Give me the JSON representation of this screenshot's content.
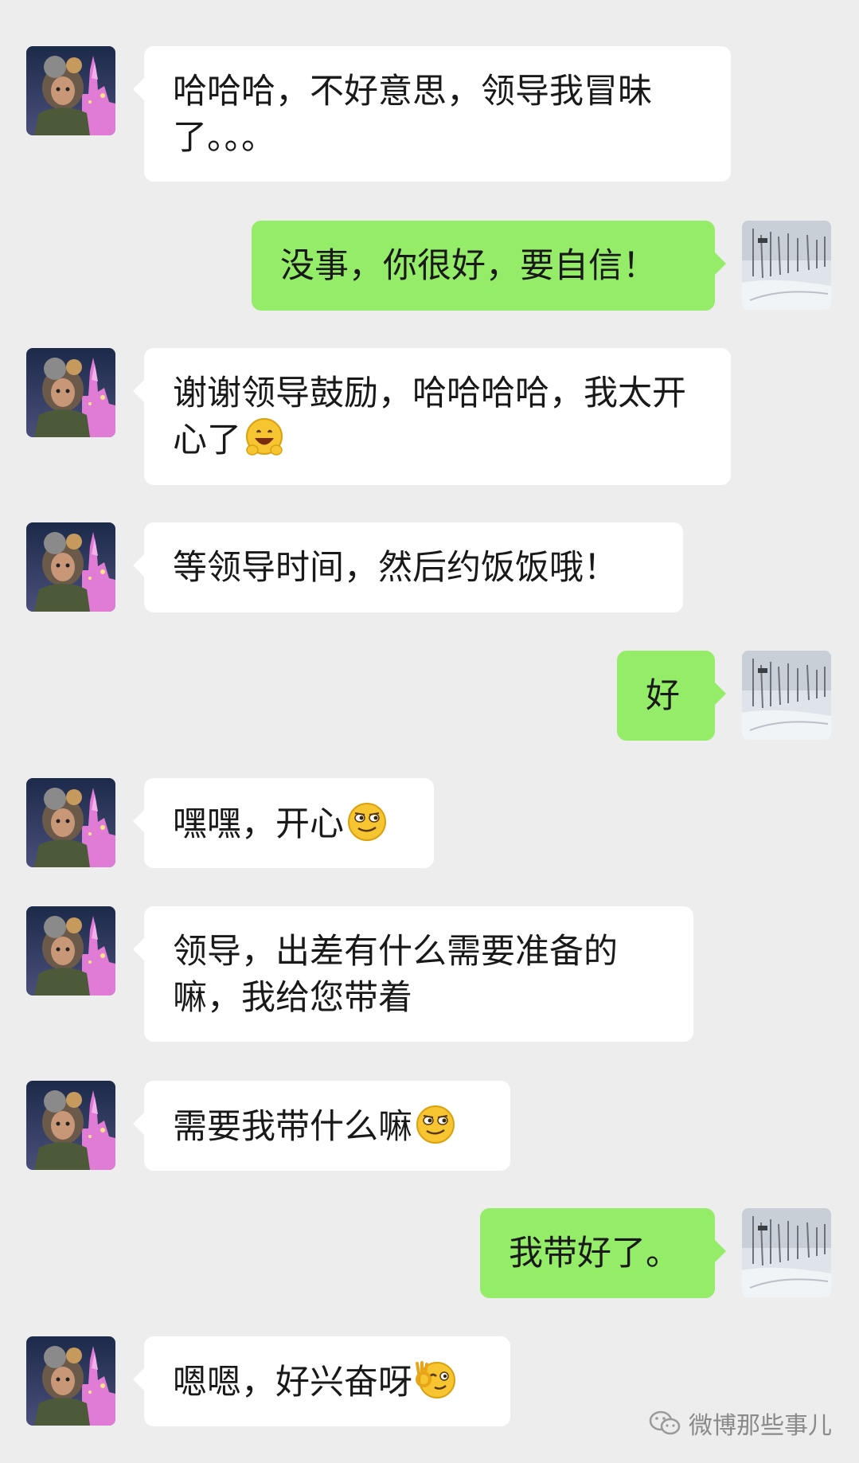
{
  "messages": [
    {
      "side": "in",
      "text": "哈哈哈，不好意思，领导我冒昧了。。。",
      "emoji": ""
    },
    {
      "side": "out",
      "text": "没事，你很好，要自信！",
      "emoji": ""
    },
    {
      "side": "in",
      "text": "谢谢领导鼓励，哈哈哈哈，我太开心了",
      "emoji": "happy-hands-emoji"
    },
    {
      "side": "in",
      "text": "等领导时间，然后约饭饭哦！",
      "emoji": ""
    },
    {
      "side": "out",
      "text": "好",
      "emoji": ""
    },
    {
      "side": "in",
      "text": "嘿嘿，开心",
      "emoji": "smirk-emoji"
    },
    {
      "side": "in",
      "text": "领导，出差有什么需要准备的嘛，我给您带着",
      "emoji": ""
    },
    {
      "side": "in",
      "text": "需要我带什么嘛",
      "emoji": "smirk-emoji"
    },
    {
      "side": "out",
      "text": "我带好了。",
      "emoji": ""
    },
    {
      "side": "in",
      "text": "嗯嗯，好兴奋呀",
      "emoji": "ok-wink-emoji"
    }
  ],
  "watermark": {
    "text": "微博那些事儿",
    "icon": "wechat-icon"
  },
  "colors": {
    "background": "#ededed",
    "incoming": "#ffffff",
    "outgoing": "#95ec69"
  }
}
